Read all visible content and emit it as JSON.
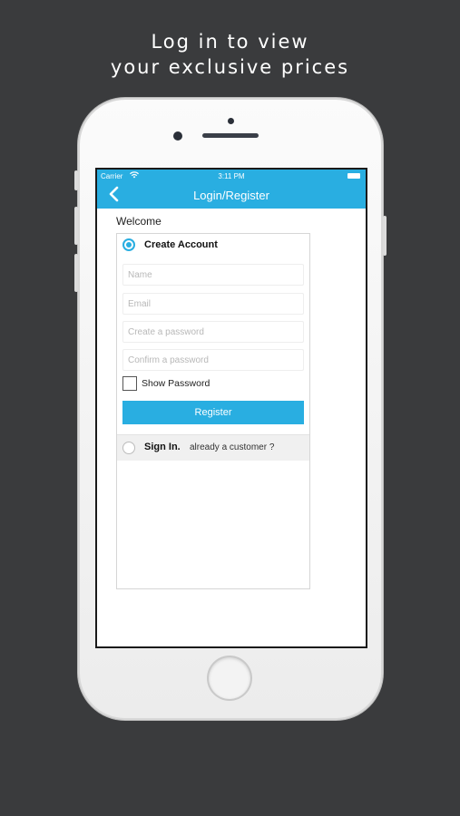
{
  "promo": {
    "line1": "Log in to view",
    "line2": "your exclusive prices"
  },
  "status_bar": {
    "carrier": "Carrier",
    "time": "3:11 PM"
  },
  "nav": {
    "back_icon": "chevron-left",
    "title": "Login/Register"
  },
  "welcome": "Welcome",
  "create_account": {
    "label": "Create Account",
    "selected": true,
    "fields": {
      "name_placeholder": "Name",
      "email_placeholder": "Email",
      "password_placeholder": "Create a password",
      "confirm_placeholder": "Confirm a password"
    },
    "show_password_label": "Show Password",
    "show_password_checked": false,
    "register_label": "Register"
  },
  "sign_in": {
    "label": "Sign In.",
    "hint": "already a customer ?",
    "selected": false
  },
  "colors": {
    "accent": "#29aee1",
    "background": "#3a3b3d"
  }
}
